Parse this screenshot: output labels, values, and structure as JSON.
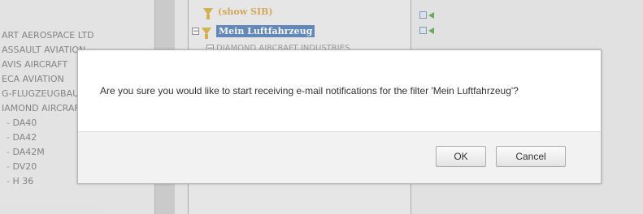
{
  "background": {
    "left_list": [
      {
        "label": "ART AEROSPACE LTD",
        "child": false
      },
      {
        "label": "ASSAULT AVIATION",
        "child": false
      },
      {
        "label": "AVIS AIRCRAFT",
        "child": false
      },
      {
        "label": "ECA AVIATION",
        "child": false
      },
      {
        "label": "G-FLUGZEUGBAU",
        "child": false
      },
      {
        "label": "IAMOND AIRCRAFT",
        "child": false
      },
      {
        "label": "DA40",
        "child": true
      },
      {
        "label": "DA42",
        "child": true
      },
      {
        "label": "DA42M",
        "child": true
      },
      {
        "label": "DV20",
        "child": true
      },
      {
        "label": "H 36",
        "child": true
      }
    ],
    "tree": {
      "show_sib": "(show SIB)",
      "selected_filter": "Mein Luftfahrzeug",
      "child_node": "DIAMOND AIRCRAFT INDUSTRIES"
    }
  },
  "dialog": {
    "message": "Are you sure you would like to start receiving e-mail notifications for the filter 'Mein Luftfahrzeug'?",
    "ok_label": "OK",
    "cancel_label": "Cancel"
  }
}
